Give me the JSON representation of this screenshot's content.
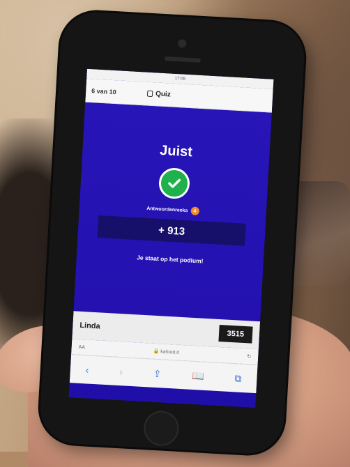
{
  "status_bar": {
    "carrier": "",
    "time": "17:08",
    "battery": ""
  },
  "nav": {
    "counter": "6 van 10",
    "title": "Quiz"
  },
  "result": {
    "title": "Juist",
    "streak_label": "Antwoordenreeks",
    "streak_count": "4",
    "score_gain": "+ 913",
    "podium_message": "Je staat op het podium!"
  },
  "player": {
    "name": "Linda",
    "score": "3515"
  },
  "browser": {
    "left_label": "AA",
    "url": "kahoot.it"
  },
  "colors": {
    "screen_bg": "#2715b8",
    "score_bar_bg": "#17106a",
    "correct_green": "#1fb14c",
    "streak_orange": "#f28a2e"
  },
  "icons": {
    "check": "check-icon",
    "flame": "flame-icon",
    "nav": "quiz-icon"
  }
}
